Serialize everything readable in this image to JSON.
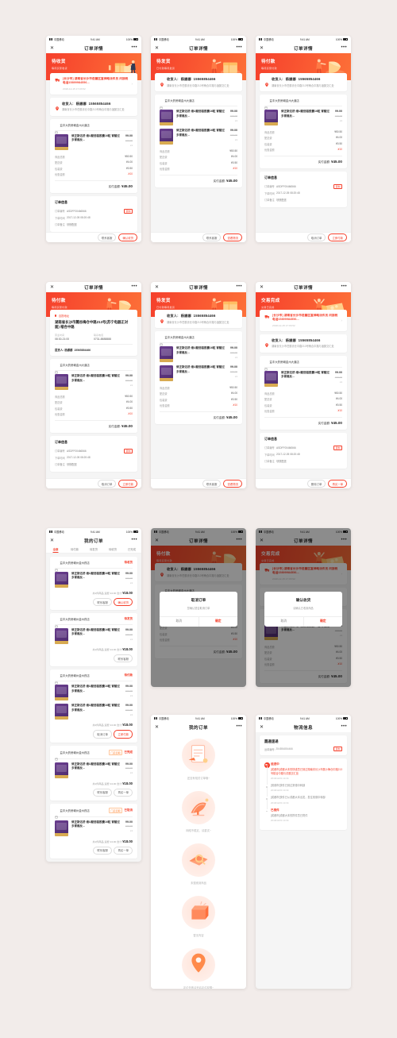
{
  "status_bar": {
    "carrier": "中国移动",
    "time": "9:41 AM",
    "battery": "100%"
  },
  "nav": {
    "close_icon": "close-icon",
    "more_icon": "more-icon",
    "title_order_detail": "订单详情",
    "title_my_orders": "我的订单",
    "title_logistics": "物流信息"
  },
  "statuses": {
    "await_receive": {
      "label": "待收货",
      "sub": "等待买家收货"
    },
    "await_ship": {
      "label": "待发货",
      "sub": "已付款等待发货"
    },
    "await_pay": {
      "label": "待付款",
      "sub": "等待买家付款"
    },
    "completed": {
      "label": "交易完成",
      "sub": "交易已完成"
    }
  },
  "shipping_notice": {
    "line": "[长沙市] 湖南省长沙市岳麓区富绅略派件员 问接税电话15899984556...",
    "time": "2018-12-15 17:03:52",
    "icon": "truck-icon",
    "chevron": "chevron-right-icon"
  },
  "receiver": {
    "label": "收货人:",
    "name": "杨娜娜",
    "phone": "15565854466",
    "address": "湖南省长沙市岳麓省仓中路213号稍合中路与淄麓交汇处",
    "pin_icon": "location-pin-icon"
  },
  "pickup": {
    "tag": "自提地址",
    "address": "湖南省长沙市麓谷梅仓中路213号(苏宁电器正对面) 榕合中路",
    "hours_label": "营业时间",
    "hours_value": "08:30-21:00",
    "phone_label": "联系电话",
    "phone_value": "0731-8888888",
    "person_label": "提货人:",
    "person_name": "杨娜娜",
    "person_phone": "15565854466"
  },
  "store": {
    "icon": "store-icon",
    "name": "益丰大药房朝金州大道店",
    "tag_pickup": "门店自取"
  },
  "product": {
    "name": "修正斯达舒 维U颠茄铝胶囊16粒 胃酸过多胃痛反...",
    "price": "¥9.00",
    "original_price": "¥10.00",
    "qty": "x1"
  },
  "fees": {
    "rows": [
      {
        "label": "商品总额",
        "value": "¥50.50"
      },
      {
        "label": "配送费",
        "value": "¥4.00"
      },
      {
        "label": "包装费",
        "value": "¥0.50"
      },
      {
        "label": "优惠金额",
        "value": "-¥10"
      }
    ],
    "total_label": "实付金额:",
    "total_value": "¥45.00"
  },
  "order_info": {
    "title": "订单信息",
    "rows": [
      {
        "key": "订单编号",
        "value": "ASDFF00466566",
        "copy": "复制"
      },
      {
        "key": "下单时间",
        "value": "2017-12-05 08:20:48"
      },
      {
        "key": "订单备注",
        "value": "尽快配送"
      }
    ]
  },
  "actions": {
    "contact_service": "联系客服",
    "confirm_receive": "确认收货",
    "cancel_order": "取消订单",
    "pay_now": "立即付款",
    "view_logistics": "查看物流",
    "buy_again": "再买一单",
    "delete_order": "删除订单"
  },
  "order_list": {
    "tabs": [
      {
        "label": "全部",
        "active": true
      },
      {
        "label": "待付款",
        "active": false
      },
      {
        "label": "待发货",
        "active": false
      },
      {
        "label": "待收货",
        "active": false
      },
      {
        "label": "已完成",
        "active": false
      }
    ],
    "orders": [
      {
        "store": "益丰大药房朝州金州药店",
        "tag": "",
        "status": "待收货",
        "items": 1,
        "summary_prefix": "共1件商品",
        "freight": "运费 ¥4.00",
        "total_label": "合计",
        "total": "¥18.00",
        "buttons": [
          {
            "label": "联系客服",
            "style": "plain"
          },
          {
            "label": "确认收货",
            "style": "primary"
          }
        ]
      },
      {
        "store": "益丰大药房朝州金州药店",
        "tag": "",
        "status": "待发货",
        "items": 1,
        "summary_prefix": "共1件商品",
        "freight": "运费 ¥4.00",
        "total_label": "合计",
        "total": "¥18.00",
        "buttons": [
          {
            "label": "联系客服",
            "style": "plain"
          }
        ]
      },
      {
        "store": "益丰大药房朝州金州药店",
        "tag": "",
        "status": "待付款",
        "items": 2,
        "summary_prefix": "共2件商品",
        "freight": "运费 ¥4.00",
        "total_label": "合计",
        "total": "¥18.00",
        "buttons": [
          {
            "label": "取消订单",
            "style": "plain"
          },
          {
            "label": "立即付款",
            "style": "primary"
          }
        ]
      },
      {
        "store": "益丰大药房朝州金州药店",
        "tag": "门店自取",
        "status": "已完成",
        "items": 1,
        "summary_prefix": "共1件商品",
        "freight": "运费 ¥4.00",
        "total_label": "合计",
        "total": "¥18.00",
        "buttons": [
          {
            "label": "联系客服",
            "style": "plain"
          },
          {
            "label": "再买一单",
            "style": "plain"
          }
        ]
      },
      {
        "store": "益丰大药房朝州金州药店",
        "tag": "门店自取",
        "status": "已取消",
        "items": 1,
        "summary_prefix": "共1件商品",
        "freight": "运费 ¥4.00",
        "total_label": "合计",
        "total": "¥18.00",
        "buttons": [
          {
            "label": "联系客服",
            "style": "plain"
          },
          {
            "label": "再买一单",
            "style": "plain"
          }
        ]
      }
    ]
  },
  "modal_cancel": {
    "title": "取消订单",
    "subtitle": "您确认是否取消订单",
    "cancel": "取消",
    "confirm": "确定"
  },
  "modal_confirm": {
    "title": "确认收货",
    "subtitle": "请确认已收到商品",
    "cancel": "取消",
    "confirm": "确定"
  },
  "empty_states": [
    {
      "icon": "notepad-icon",
      "text": "还没有相关订单哦~"
    },
    {
      "icon": "satellite-icon",
      "text": "网络不稳定，请重试~"
    },
    {
      "icon": "search-box-icon",
      "text": "未搜索到商品"
    },
    {
      "icon": "empty-box-icon",
      "text": "暂无内容"
    },
    {
      "icon": "location-pin-icon",
      "text": "定位失败请开启定位权限~"
    }
  ],
  "logistics": {
    "courier": "圆通速递",
    "tracking_label": "运单编号:",
    "tracking_no": "354854854466",
    "copy": "复制",
    "events": [
      {
        "status": "运送中",
        "text": "[成都市]成都大本的快递员已到达湖南省长沙市麓沙梅仓中路213号榕合中路与洪麓交汇处",
        "time": "2019/12/24 14:34",
        "current": true
      },
      {
        "status": "",
        "text": "[常德市]快件已到达常德中转部",
        "time": "2019/12/24 14:34",
        "current": false
      },
      {
        "status": "",
        "text": "[成都市]快件已从成都大本出发，发往常德中转部",
        "time": "2019/12/24 14:34",
        "current": false
      },
      {
        "status": "已揽件",
        "text": "[成都市]成都大本的揽件员已揽件",
        "time": "2019/12/24 14:34",
        "current": false
      }
    ]
  },
  "colors": {
    "brand_red": "#f5402c",
    "brand_orange": "#fd7038",
    "page_bg": "#f2ecea",
    "card_bg": "#ffffff",
    "text_muted": "#9a9a9a"
  }
}
